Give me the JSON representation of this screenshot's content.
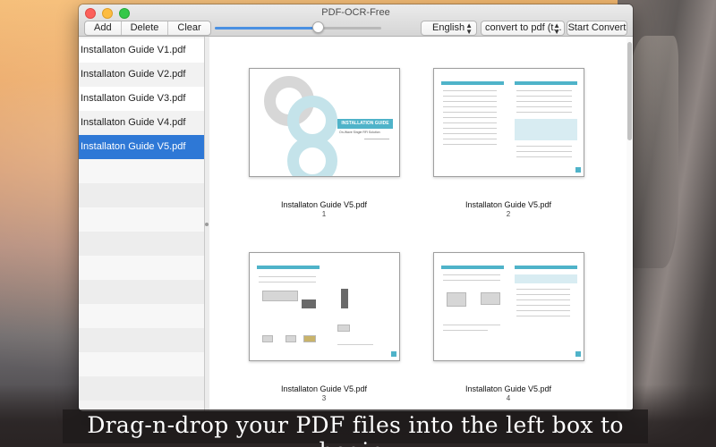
{
  "window": {
    "title": "PDF-OCR-Free"
  },
  "toolbar": {
    "add_label": "Add",
    "delete_label": "Delete",
    "clear_label": "Clear",
    "zoom_level": 0.62,
    "language_value": "English",
    "mode_value": "convert to pdf (t...",
    "convert_label": "Start Convert"
  },
  "sidebar": {
    "items": [
      {
        "label": "Installaton Guide V1.pdf",
        "selected": false
      },
      {
        "label": "Installaton Guide V2.pdf",
        "selected": false
      },
      {
        "label": "Installaton Guide V3.pdf",
        "selected": false
      },
      {
        "label": "Installaton Guide V4.pdf",
        "selected": false
      },
      {
        "label": "Installaton Guide V5.pdf",
        "selected": true
      }
    ]
  },
  "pages": [
    {
      "name": "Installaton Guide V5.pdf",
      "number": "1"
    },
    {
      "name": "Installaton Guide V5.pdf",
      "number": "2"
    },
    {
      "name": "Installaton Guide V5.pdf",
      "number": "3"
    },
    {
      "name": "Installaton Guide V5.pdf",
      "number": "4"
    }
  ],
  "page1_art": {
    "heading": "INSTALLATION GUIDE",
    "subheading": "On-Wave Single RFI Solution"
  },
  "caption": "Drag-n-drop your PDF files into the left box to begin.",
  "colors": {
    "selection": "#2e78d6",
    "accent": "#4fb3c9",
    "close": "#fc605b",
    "minimize": "#fdbc40",
    "maximize": "#34c84a"
  }
}
